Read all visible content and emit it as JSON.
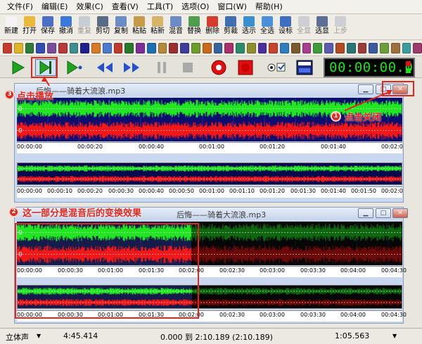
{
  "menu": [
    "文件(F)",
    "编辑(E)",
    "效果(C)",
    "查看(V)",
    "工具(T)",
    "选项(O)",
    "窗口(W)",
    "帮助(H)"
  ],
  "toolbar": [
    {
      "label": "新建",
      "color": "#f4f4f4",
      "enabled": true
    },
    {
      "label": "打开",
      "color": "#e8b93b",
      "enabled": true
    },
    {
      "label": "保存",
      "color": "#4a6fc4",
      "enabled": true
    },
    {
      "label": "撤消",
      "color": "#3c78d8",
      "enabled": true
    },
    {
      "label": "重复",
      "color": "#9aa6bf",
      "enabled": false
    },
    {
      "label": "剪切",
      "color": "#5b6a85",
      "enabled": true
    },
    {
      "label": "复制",
      "color": "#6b8cc7",
      "enabled": true
    },
    {
      "label": "粘贴",
      "color": "#c79a4a",
      "enabled": true
    },
    {
      "label": "粘新",
      "color": "#d9b36a",
      "enabled": true
    },
    {
      "label": "混音",
      "color": "#6b8cc7",
      "enabled": true
    },
    {
      "label": "替换",
      "color": "#4f9e4f",
      "enabled": true
    },
    {
      "label": "删除",
      "color": "#d43d2e",
      "enabled": true
    },
    {
      "label": "剪裁",
      "color": "#3f6fb0",
      "enabled": true
    },
    {
      "label": "选示",
      "color": "#3c8fcf",
      "enabled": true
    },
    {
      "label": "全选",
      "color": "#4a8fd9",
      "enabled": true
    },
    {
      "label": "设标",
      "color": "#3c6ec2",
      "enabled": true
    },
    {
      "label": "全显",
      "color": "#a4adc0",
      "enabled": false
    },
    {
      "label": "选显",
      "color": "#5c6e96",
      "enabled": true
    },
    {
      "label": "上步",
      "color": "#a4adc0",
      "enabled": false
    }
  ],
  "effects_colors": [
    "#c73b2e",
    "#e0b426",
    "#2f7b3a",
    "#2f4fb3",
    "#7a4c9e",
    "#b93a3a",
    "#3d8f8f",
    "#1f1f8f",
    "#d87a25",
    "#4a7bd0",
    "#c0392b",
    "#277a27",
    "#7e2d99",
    "#1c6fb5",
    "#b5893a",
    "#9b2f2f",
    "#3c3c9c",
    "#6c9e28",
    "#c76a1b",
    "#35659e",
    "#aa2f6c",
    "#2b8c6c",
    "#8f8f2b",
    "#4b2fa0",
    "#c8432c",
    "#2e7fc2",
    "#7a5b2e",
    "#a93c8e",
    "#3d9d3d",
    "#5b5bb0",
    "#b44a22",
    "#2a7575",
    "#9e3b3b",
    "#3b5b9e",
    "#6e9e3b",
    "#9e6e3b",
    "#3b9e9e",
    "#9e3b6e"
  ],
  "transport": {
    "time": "00:00:00.0"
  },
  "window1": {
    "title": "后悔——骑着大流浪.mp3",
    "ruler_ticks": [
      "00:00:00",
      "00:00:20",
      "00:00:40",
      "00:01:00",
      "00:01:20",
      "00:01:40",
      "00:02:0"
    ],
    "overview_ticks": [
      "00:00:00",
      "00:00:10",
      "00:00:20",
      "00:00:30",
      "00:00:40",
      "00:00:50",
      "00:01:00",
      "00:01:10",
      "00:01:20",
      "00:01:30",
      "00:01:40",
      "00:01:50",
      "00:02:0"
    ]
  },
  "window2": {
    "title": "后悔——骑着大流浪.mp3",
    "ruler_ticks": [
      "00:00:00",
      "00:00:30",
      "00:01:00",
      "00:01:30",
      "00:02:00",
      "00:02:30",
      "00:03:00",
      "00:03:30",
      "00:04:00",
      "00:04:30"
    ],
    "overview_ticks": [
      "00:00:00",
      "00:00:30",
      "00:01:00",
      "00:01:30",
      "00:02:00",
      "00:02:30",
      "00:03:00",
      "00:03:30",
      "00:04:00",
      "00:04:30"
    ]
  },
  "channel_label": "0",
  "annotations": {
    "a1_num": "1",
    "a1_text": "点击关闭",
    "a2_num": "2",
    "a2_text": "这一部分是混音后的变换效果",
    "a3_num": "3",
    "a3_text": "点击播放"
  },
  "status": {
    "mode": "立体声",
    "length": "4:45.414",
    "selection": "0.000 到 2:10.189 (2:10.189)",
    "position": "1:05.563"
  },
  "colors": {
    "wave_green": "#22e622",
    "wave_red": "#f01818",
    "annotation_red": "#e3261b"
  }
}
